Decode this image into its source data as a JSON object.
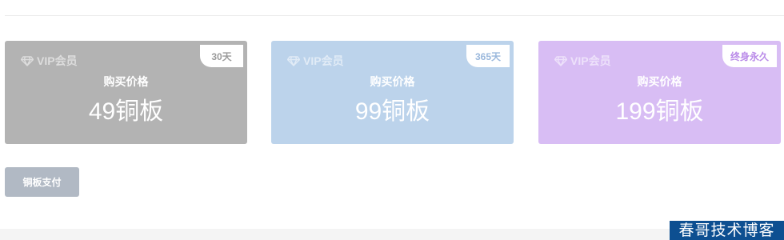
{
  "membership": {
    "plans": [
      {
        "brand": "VIP会员",
        "duration": "30天",
        "price_label": "购买价格",
        "price": "49铜板",
        "background": "#b3b3b3",
        "accent": "#9a9a9a"
      },
      {
        "brand": "VIP会员",
        "duration": "365天",
        "price_label": "购买价格",
        "price": "99铜板",
        "background": "#bcd3eb",
        "accent": "#9ab8dc"
      },
      {
        "brand": "VIP会员",
        "duration": "终身永久",
        "price_label": "购买价格",
        "price": "199铜板",
        "background": "#d8bdf4",
        "accent": "#b98ae8"
      }
    ],
    "icon": "diamond-icon"
  },
  "actions": {
    "pay_label": "铜板支付"
  },
  "watermark": {
    "text": "春哥技术博客",
    "background": "#0d4f91"
  }
}
